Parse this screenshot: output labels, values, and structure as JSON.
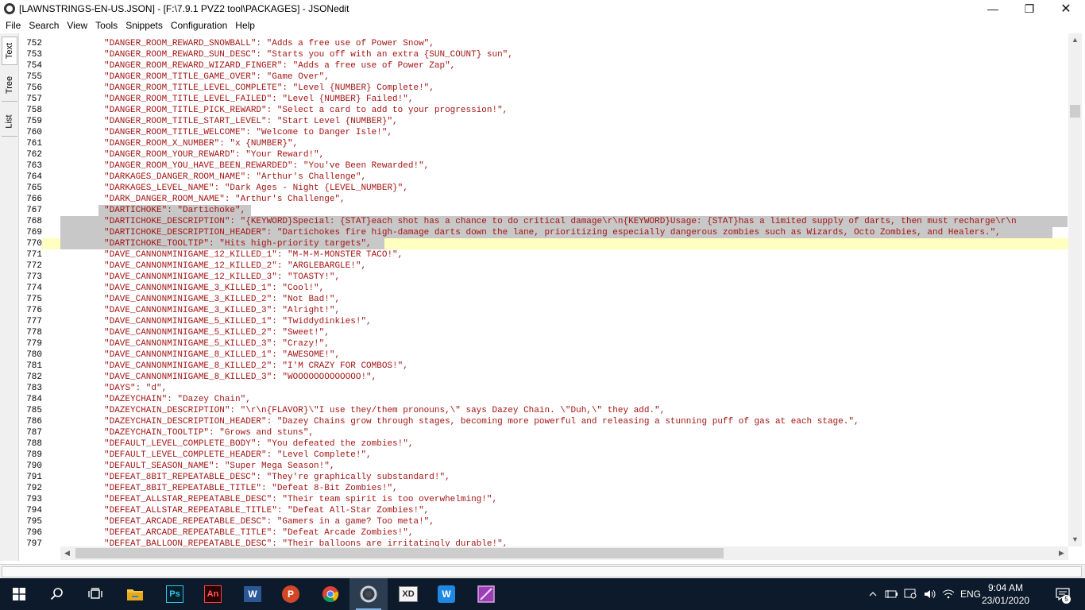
{
  "window": {
    "title": "[LAWNSTRINGS-EN-US.JSON] - [F:\\7.9.1 PVZ2 tool\\PACKAGES] - JSONedit",
    "minimize": "—",
    "maximize": "❐",
    "close": "✕"
  },
  "menu": {
    "items": [
      "File",
      "Search",
      "View",
      "Tools",
      "Snippets",
      "Configuration",
      "Help"
    ]
  },
  "side_tabs": {
    "text": "Text",
    "tree": "Tree",
    "list": "List"
  },
  "editor": {
    "lines": [
      {
        "num": "752",
        "code": "\"DANGER_ROOM_REWARD_SNOWBALL\": \"Adds a free use of Power Snow\","
      },
      {
        "num": "753",
        "code": "\"DANGER_ROOM_REWARD_SUN_DESC\": \"Starts you off with an extra {SUN_COUNT} sun\","
      },
      {
        "num": "754",
        "code": "\"DANGER_ROOM_REWARD_WIZARD_FINGER\": \"Adds a free use of Power Zap\","
      },
      {
        "num": "755",
        "code": "\"DANGER_ROOM_TITLE_GAME_OVER\": \"Game Over\","
      },
      {
        "num": "756",
        "code": "\"DANGER_ROOM_TITLE_LEVEL_COMPLETE\": \"Level {NUMBER} Complete!\","
      },
      {
        "num": "757",
        "code": "\"DANGER_ROOM_TITLE_LEVEL_FAILED\": \"Level {NUMBER} Failed!\","
      },
      {
        "num": "758",
        "code": "\"DANGER_ROOM_TITLE_PICK_REWARD\": \"Select a card to add to your progression!\","
      },
      {
        "num": "759",
        "code": "\"DANGER_ROOM_TITLE_START_LEVEL\": \"Start Level {NUMBER}\","
      },
      {
        "num": "760",
        "code": "\"DANGER_ROOM_TITLE_WELCOME\": \"Welcome to Danger Isle!\","
      },
      {
        "num": "761",
        "code": "\"DANGER_ROOM_X_NUMBER\": \"x {NUMBER}\","
      },
      {
        "num": "762",
        "code": "\"DANGER_ROOM_YOUR_REWARD\": \"Your Reward!\","
      },
      {
        "num": "763",
        "code": "\"DANGER_ROOM_YOU_HAVE_BEEN_REWARDED\": \"You've Been Rewarded!\","
      },
      {
        "num": "764",
        "code": "\"DARKAGES_DANGER_ROOM_NAME\": \"Arthur's Challenge\","
      },
      {
        "num": "765",
        "code": "\"DARKAGES_LEVEL_NAME\": \"Dark Ages - Night {LEVEL_NUMBER}\","
      },
      {
        "num": "766",
        "code": "\"DARK_DANGER_ROOM_NAME\": \"Arthur's Challenge\","
      },
      {
        "num": "767",
        "code": "\"DARTICHOKE\": \"Dartichoke\","
      },
      {
        "num": "768",
        "code": "\"DARTICHOKE_DESCRIPTION\": \"{KEYWORD}Special: {STAT}each shot has a chance to do critical damage\\r\\n{KEYWORD}Usage: {STAT}has a limited supply of darts, then must recharge\\r\\n"
      },
      {
        "num": "769",
        "code": "\"DARTICHOKE_DESCRIPTION_HEADER\": \"Dartichokes fire high-damage darts down the lane, prioritizing especially dangerous zombies such as Wizards, Octo Zombies, and Healers.\","
      },
      {
        "num": "770",
        "code": "\"DARTICHOKE_TOOLTIP\": \"Hits high-priority targets\","
      },
      {
        "num": "771",
        "code": "\"DAVE_CANNONMINIGAME_12_KILLED_1\": \"M-M-M-MONSTER TACO!\","
      },
      {
        "num": "772",
        "code": "\"DAVE_CANNONMINIGAME_12_KILLED_2\": \"ARGLEBARGLE!\","
      },
      {
        "num": "773",
        "code": "\"DAVE_CANNONMINIGAME_12_KILLED_3\": \"TOASTY!\","
      },
      {
        "num": "774",
        "code": "\"DAVE_CANNONMINIGAME_3_KILLED_1\": \"Cool!\","
      },
      {
        "num": "775",
        "code": "\"DAVE_CANNONMINIGAME_3_KILLED_2\": \"Not Bad!\","
      },
      {
        "num": "776",
        "code": "\"DAVE_CANNONMINIGAME_3_KILLED_3\": \"Alright!\","
      },
      {
        "num": "777",
        "code": "\"DAVE_CANNONMINIGAME_5_KILLED_1\": \"Twiddydinkies!\","
      },
      {
        "num": "778",
        "code": "\"DAVE_CANNONMINIGAME_5_KILLED_2\": \"Sweet!\","
      },
      {
        "num": "779",
        "code": "\"DAVE_CANNONMINIGAME_5_KILLED_3\": \"Crazy!\","
      },
      {
        "num": "780",
        "code": "\"DAVE_CANNONMINIGAME_8_KILLED_1\": \"AWESOME!\","
      },
      {
        "num": "781",
        "code": "\"DAVE_CANNONMINIGAME_8_KILLED_2\": \"I'M CRAZY FOR COMBOS!\","
      },
      {
        "num": "782",
        "code": "\"DAVE_CANNONMINIGAME_8_KILLED_3\": \"WOOOOOOOOOOOOO!\","
      },
      {
        "num": "783",
        "code": "\"DAYS\": \"d\","
      },
      {
        "num": "784",
        "code": "\"DAZEYCHAIN\": \"Dazey Chain\","
      },
      {
        "num": "785",
        "code": "\"DAZEYCHAIN_DESCRIPTION\": \"\\r\\n{FLAVOR}\\\"I use they/them pronouns,\\\" says Dazey Chain. \\\"Duh,\\\" they add.\","
      },
      {
        "num": "786",
        "code": "\"DAZEYCHAIN_DESCRIPTION_HEADER\": \"Dazey Chains grow through stages, becoming more powerful and releasing a stunning puff of gas at each stage.\","
      },
      {
        "num": "787",
        "code": "\"DAZEYCHAIN_TOOLTIP\": \"Grows and stuns\","
      },
      {
        "num": "788",
        "code": "\"DEFAULT_LEVEL_COMPLETE_BODY\": \"You defeated the zombies!\","
      },
      {
        "num": "789",
        "code": "\"DEFAULT_LEVEL_COMPLETE_HEADER\": \"Level Complete!\","
      },
      {
        "num": "790",
        "code": "\"DEFAULT_SEASON_NAME\": \"Super Mega Season!\","
      },
      {
        "num": "791",
        "code": "\"DEFEAT_8BIT_REPEATABLE_DESC\": \"They're graphically substandard!\","
      },
      {
        "num": "792",
        "code": "\"DEFEAT_8BIT_REPEATABLE_TITLE\": \"Defeat 8-Bit Zombies!\","
      },
      {
        "num": "793",
        "code": "\"DEFEAT_ALLSTAR_REPEATABLE_DESC\": \"Their team spirit is too overwhelming!\","
      },
      {
        "num": "794",
        "code": "\"DEFEAT_ALLSTAR_REPEATABLE_TITLE\": \"Defeat All-Star Zombies!\","
      },
      {
        "num": "795",
        "code": "\"DEFEAT_ARCADE_REPEATABLE_DESC\": \"Gamers in a game? Too meta!\","
      },
      {
        "num": "796",
        "code": "\"DEFEAT_ARCADE_REPEATABLE_TITLE\": \"Defeat Arcade Zombies!\","
      },
      {
        "num": "797",
        "code": "\"DEFEAT_BALLOON_REPEATABLE_DESC\": \"Their balloons are irritatingly durable!\","
      }
    ]
  },
  "scrollbars": {
    "up": "▲",
    "down": "▼",
    "left": "◀",
    "right": "▶"
  },
  "taskbar": {
    "apps": [
      "start",
      "search",
      "task-view",
      "file-explorer",
      "photoshop",
      "acrobat",
      "word",
      "powerpoint",
      "chrome",
      "jsonedit",
      "xd",
      "writer",
      "app-purple"
    ],
    "photoshop_label": "Ps",
    "acrobat_label": "An",
    "word_label": "W",
    "powerpoint_label": "P",
    "xd_label": "XD",
    "writer_label": "W",
    "language": "ENG",
    "time": "9:04 AM",
    "date": "23/01/2020",
    "notification_count": "5"
  },
  "colors": {
    "code_text": "#a31515",
    "selection": "#c8c8c8",
    "current_line": "#ffffc0",
    "taskbar": "#0c1a2b"
  }
}
